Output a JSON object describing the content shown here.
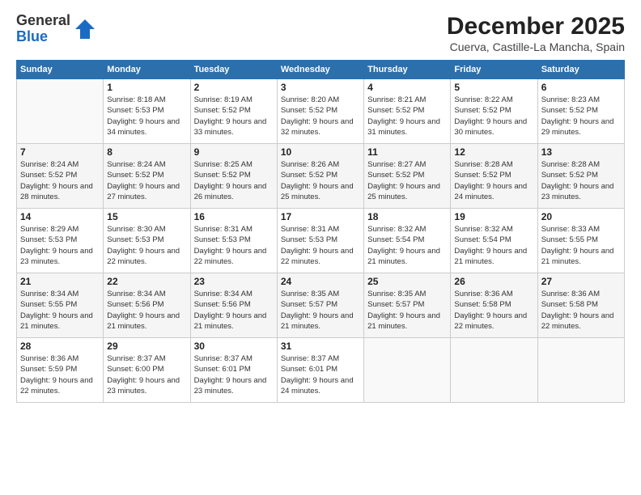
{
  "logo": {
    "general": "General",
    "blue": "Blue"
  },
  "title": {
    "month": "December 2025",
    "location": "Cuerva, Castille-La Mancha, Spain"
  },
  "days_of_week": [
    "Sunday",
    "Monday",
    "Tuesday",
    "Wednesday",
    "Thursday",
    "Friday",
    "Saturday"
  ],
  "weeks": [
    [
      {
        "day": "",
        "sunrise": "",
        "sunset": "",
        "daylight": ""
      },
      {
        "day": "1",
        "sunrise": "Sunrise: 8:18 AM",
        "sunset": "Sunset: 5:53 PM",
        "daylight": "Daylight: 9 hours and 34 minutes."
      },
      {
        "day": "2",
        "sunrise": "Sunrise: 8:19 AM",
        "sunset": "Sunset: 5:52 PM",
        "daylight": "Daylight: 9 hours and 33 minutes."
      },
      {
        "day": "3",
        "sunrise": "Sunrise: 8:20 AM",
        "sunset": "Sunset: 5:52 PM",
        "daylight": "Daylight: 9 hours and 32 minutes."
      },
      {
        "day": "4",
        "sunrise": "Sunrise: 8:21 AM",
        "sunset": "Sunset: 5:52 PM",
        "daylight": "Daylight: 9 hours and 31 minutes."
      },
      {
        "day": "5",
        "sunrise": "Sunrise: 8:22 AM",
        "sunset": "Sunset: 5:52 PM",
        "daylight": "Daylight: 9 hours and 30 minutes."
      },
      {
        "day": "6",
        "sunrise": "Sunrise: 8:23 AM",
        "sunset": "Sunset: 5:52 PM",
        "daylight": "Daylight: 9 hours and 29 minutes."
      }
    ],
    [
      {
        "day": "7",
        "sunrise": "Sunrise: 8:24 AM",
        "sunset": "Sunset: 5:52 PM",
        "daylight": "Daylight: 9 hours and 28 minutes."
      },
      {
        "day": "8",
        "sunrise": "Sunrise: 8:24 AM",
        "sunset": "Sunset: 5:52 PM",
        "daylight": "Daylight: 9 hours and 27 minutes."
      },
      {
        "day": "9",
        "sunrise": "Sunrise: 8:25 AM",
        "sunset": "Sunset: 5:52 PM",
        "daylight": "Daylight: 9 hours and 26 minutes."
      },
      {
        "day": "10",
        "sunrise": "Sunrise: 8:26 AM",
        "sunset": "Sunset: 5:52 PM",
        "daylight": "Daylight: 9 hours and 25 minutes."
      },
      {
        "day": "11",
        "sunrise": "Sunrise: 8:27 AM",
        "sunset": "Sunset: 5:52 PM",
        "daylight": "Daylight: 9 hours and 25 minutes."
      },
      {
        "day": "12",
        "sunrise": "Sunrise: 8:28 AM",
        "sunset": "Sunset: 5:52 PM",
        "daylight": "Daylight: 9 hours and 24 minutes."
      },
      {
        "day": "13",
        "sunrise": "Sunrise: 8:28 AM",
        "sunset": "Sunset: 5:52 PM",
        "daylight": "Daylight: 9 hours and 23 minutes."
      }
    ],
    [
      {
        "day": "14",
        "sunrise": "Sunrise: 8:29 AM",
        "sunset": "Sunset: 5:53 PM",
        "daylight": "Daylight: 9 hours and 23 minutes."
      },
      {
        "day": "15",
        "sunrise": "Sunrise: 8:30 AM",
        "sunset": "Sunset: 5:53 PM",
        "daylight": "Daylight: 9 hours and 22 minutes."
      },
      {
        "day": "16",
        "sunrise": "Sunrise: 8:31 AM",
        "sunset": "Sunset: 5:53 PM",
        "daylight": "Daylight: 9 hours and 22 minutes."
      },
      {
        "day": "17",
        "sunrise": "Sunrise: 8:31 AM",
        "sunset": "Sunset: 5:53 PM",
        "daylight": "Daylight: 9 hours and 22 minutes."
      },
      {
        "day": "18",
        "sunrise": "Sunrise: 8:32 AM",
        "sunset": "Sunset: 5:54 PM",
        "daylight": "Daylight: 9 hours and 21 minutes."
      },
      {
        "day": "19",
        "sunrise": "Sunrise: 8:32 AM",
        "sunset": "Sunset: 5:54 PM",
        "daylight": "Daylight: 9 hours and 21 minutes."
      },
      {
        "day": "20",
        "sunrise": "Sunrise: 8:33 AM",
        "sunset": "Sunset: 5:55 PM",
        "daylight": "Daylight: 9 hours and 21 minutes."
      }
    ],
    [
      {
        "day": "21",
        "sunrise": "Sunrise: 8:34 AM",
        "sunset": "Sunset: 5:55 PM",
        "daylight": "Daylight: 9 hours and 21 minutes."
      },
      {
        "day": "22",
        "sunrise": "Sunrise: 8:34 AM",
        "sunset": "Sunset: 5:56 PM",
        "daylight": "Daylight: 9 hours and 21 minutes."
      },
      {
        "day": "23",
        "sunrise": "Sunrise: 8:34 AM",
        "sunset": "Sunset: 5:56 PM",
        "daylight": "Daylight: 9 hours and 21 minutes."
      },
      {
        "day": "24",
        "sunrise": "Sunrise: 8:35 AM",
        "sunset": "Sunset: 5:57 PM",
        "daylight": "Daylight: 9 hours and 21 minutes."
      },
      {
        "day": "25",
        "sunrise": "Sunrise: 8:35 AM",
        "sunset": "Sunset: 5:57 PM",
        "daylight": "Daylight: 9 hours and 21 minutes."
      },
      {
        "day": "26",
        "sunrise": "Sunrise: 8:36 AM",
        "sunset": "Sunset: 5:58 PM",
        "daylight": "Daylight: 9 hours and 22 minutes."
      },
      {
        "day": "27",
        "sunrise": "Sunrise: 8:36 AM",
        "sunset": "Sunset: 5:58 PM",
        "daylight": "Daylight: 9 hours and 22 minutes."
      }
    ],
    [
      {
        "day": "28",
        "sunrise": "Sunrise: 8:36 AM",
        "sunset": "Sunset: 5:59 PM",
        "daylight": "Daylight: 9 hours and 22 minutes."
      },
      {
        "day": "29",
        "sunrise": "Sunrise: 8:37 AM",
        "sunset": "Sunset: 6:00 PM",
        "daylight": "Daylight: 9 hours and 23 minutes."
      },
      {
        "day": "30",
        "sunrise": "Sunrise: 8:37 AM",
        "sunset": "Sunset: 6:01 PM",
        "daylight": "Daylight: 9 hours and 23 minutes."
      },
      {
        "day": "31",
        "sunrise": "Sunrise: 8:37 AM",
        "sunset": "Sunset: 6:01 PM",
        "daylight": "Daylight: 9 hours and 24 minutes."
      },
      {
        "day": "",
        "sunrise": "",
        "sunset": "",
        "daylight": ""
      },
      {
        "day": "",
        "sunrise": "",
        "sunset": "",
        "daylight": ""
      },
      {
        "day": "",
        "sunrise": "",
        "sunset": "",
        "daylight": ""
      }
    ]
  ]
}
